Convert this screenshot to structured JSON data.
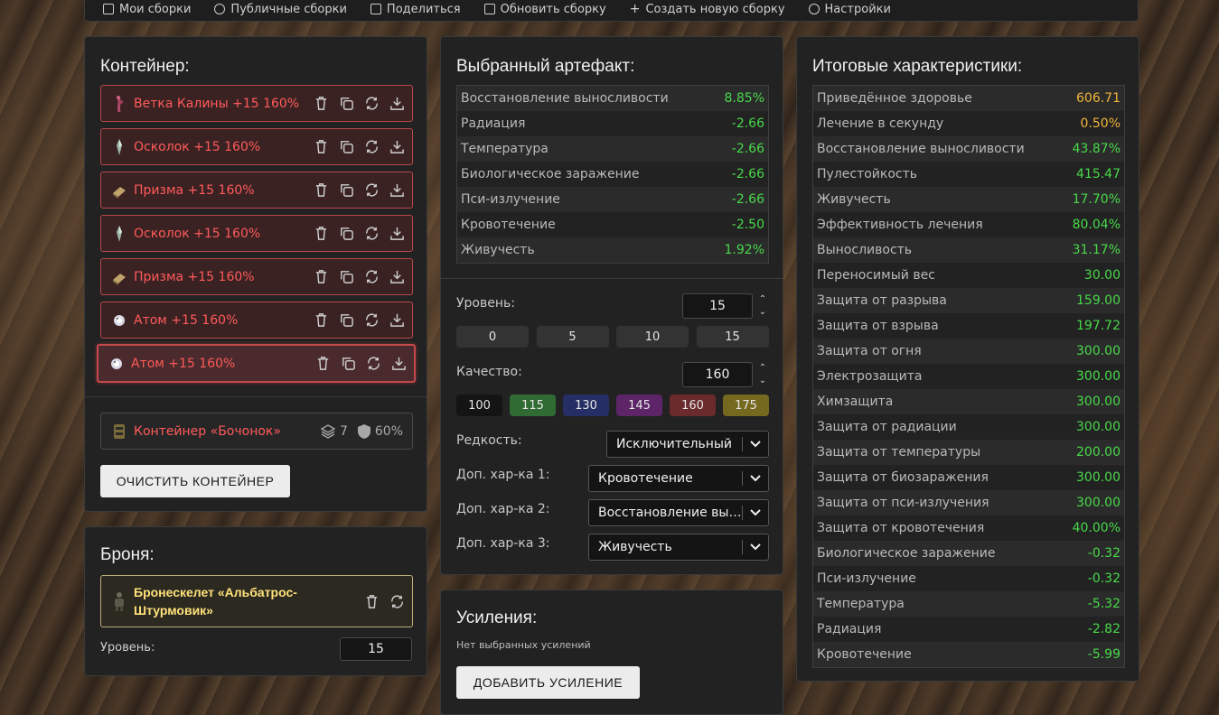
{
  "nav": [
    {
      "label": "Мои сборки",
      "icon": "folder-icon"
    },
    {
      "label": "Публичные сборки",
      "icon": "globe-icon"
    },
    {
      "label": "Поделиться",
      "icon": "share-icon"
    },
    {
      "label": "Обновить сборку",
      "icon": "save-icon"
    },
    {
      "label": "Создать новую сборку",
      "icon": "plus-icon"
    },
    {
      "label": "Настройки",
      "icon": "gear-icon"
    }
  ],
  "container": {
    "title": "Контейнер:",
    "artifacts": [
      {
        "name": "Ветка Калины +15 160%",
        "icon": "branch-icon"
      },
      {
        "name": "Осколок +15 160%",
        "icon": "shard-icon"
      },
      {
        "name": "Призма +15 160%",
        "icon": "prism-icon"
      },
      {
        "name": "Осколок +15 160%",
        "icon": "shard-icon"
      },
      {
        "name": "Призма +15 160%",
        "icon": "prism-icon"
      },
      {
        "name": "Атом +15 160%",
        "icon": "atom-icon"
      },
      {
        "name": "Атом +15 160%",
        "icon": "atom-icon"
      }
    ],
    "barrel": {
      "name": "Контейнер «Бочонок»",
      "slots": "7",
      "protection": "60%"
    },
    "clear_label": "ОЧИСТИТЬ КОНТЕЙНЕР"
  },
  "armor": {
    "title": "Броня:",
    "name": "Бронескелет «Альбатрос-Штурмовик»",
    "level_label": "Уровень:",
    "level": "15"
  },
  "artifact": {
    "title": "Выбранный артефакт:",
    "stats": [
      {
        "name": "Восстановление выносливости",
        "value": "8.85%",
        "color": "#48d948"
      },
      {
        "name": "Радиация",
        "value": "-2.66",
        "color": "#48d948"
      },
      {
        "name": "Температура",
        "value": "-2.66",
        "color": "#48d948"
      },
      {
        "name": "Биологическое заражение",
        "value": "-2.66",
        "color": "#48d948"
      },
      {
        "name": "Пси-излучение",
        "value": "-2.66",
        "color": "#48d948"
      },
      {
        "name": "Кровотечение",
        "value": "-2.50",
        "color": "#48d948"
      },
      {
        "name": "Живучесть",
        "value": "1.92%",
        "color": "#48d948"
      }
    ],
    "level_label": "Уровень:",
    "level": "15",
    "level_presets": [
      "0",
      "5",
      "10",
      "15"
    ],
    "quality_label": "Качество:",
    "quality": "160",
    "quality_presets": [
      {
        "label": "100",
        "color": "#141414"
      },
      {
        "label": "115",
        "color": "#2f6b33"
      },
      {
        "label": "130",
        "color": "#262e66"
      },
      {
        "label": "145",
        "color": "#5d2467"
      },
      {
        "label": "160",
        "color": "#6b2a2c"
      },
      {
        "label": "175",
        "color": "#75681f"
      }
    ],
    "rarity_label": "Редкость:",
    "rarity": "Исключительный",
    "extra1_label": "Доп. хар-ка 1:",
    "extra1": "Кровотечение",
    "extra2_label": "Доп. хар-ка 2:",
    "extra2": "Восстановление выносливости",
    "extra3_label": "Доп. хар-ка 3:",
    "extra3": "Живучесть"
  },
  "boosts": {
    "title": "Усиления:",
    "empty_text": "Нет выбранных усилений",
    "add_label": "ДОБАВИТЬ УСИЛЕНИЕ"
  },
  "totals": {
    "title": "Итоговые характеристики:",
    "stats": [
      {
        "name": "Приведённое здоровье",
        "value": "606.71",
        "color": "#f0b437"
      },
      {
        "name": "Лечение в секунду",
        "value": "0.50%",
        "color": "#f0b437"
      },
      {
        "name": "Восстановление выносливости",
        "value": "43.87%",
        "color": "#48d948"
      },
      {
        "name": "Пулестойкость",
        "value": "415.47",
        "color": "#48d948"
      },
      {
        "name": "Живучесть",
        "value": "17.70%",
        "color": "#48d948"
      },
      {
        "name": "Эффективность лечения",
        "value": "80.04%",
        "color": "#48d948"
      },
      {
        "name": "Выносливость",
        "value": "31.17%",
        "color": "#48d948"
      },
      {
        "name": "Переносимый вес",
        "value": "30.00",
        "color": "#48d948"
      },
      {
        "name": "Защита от разрыва",
        "value": "159.00",
        "color": "#48d948"
      },
      {
        "name": "Защита от взрыва",
        "value": "197.72",
        "color": "#48d948"
      },
      {
        "name": "Защита от огня",
        "value": "300.00",
        "color": "#48d948"
      },
      {
        "name": "Электрозащита",
        "value": "300.00",
        "color": "#48d948"
      },
      {
        "name": "Химзащита",
        "value": "300.00",
        "color": "#48d948"
      },
      {
        "name": "Защита от радиации",
        "value": "300.00",
        "color": "#48d948"
      },
      {
        "name": "Защита от температуры",
        "value": "200.00",
        "color": "#48d948"
      },
      {
        "name": "Защита от биозаражения",
        "value": "300.00",
        "color": "#48d948"
      },
      {
        "name": "Защита от пси-излучения",
        "value": "300.00",
        "color": "#48d948"
      },
      {
        "name": "Защита от кровотечения",
        "value": "40.00%",
        "color": "#48d948"
      },
      {
        "name": "Биологическое заражение",
        "value": "-0.32",
        "color": "#48d948"
      },
      {
        "name": "Пси-излучение",
        "value": "-0.32",
        "color": "#48d948"
      },
      {
        "name": "Температура",
        "value": "-5.32",
        "color": "#48d948"
      },
      {
        "name": "Радиация",
        "value": "-2.82",
        "color": "#48d948"
      },
      {
        "name": "Кровотечение",
        "value": "-5.99",
        "color": "#48d948"
      }
    ]
  }
}
